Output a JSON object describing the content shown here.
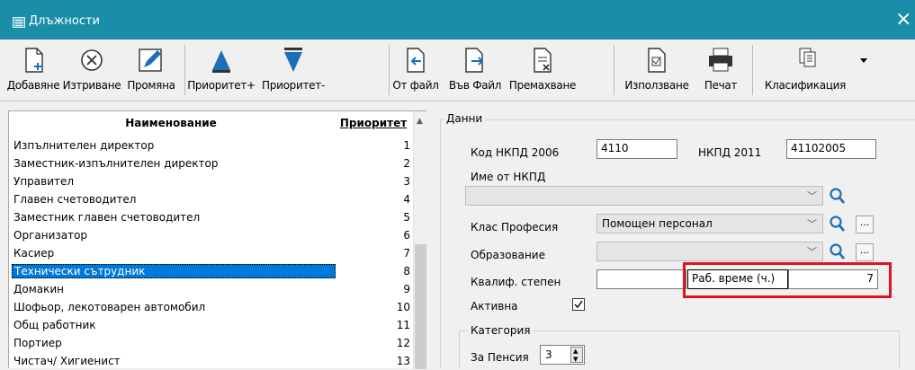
{
  "window": {
    "title": "Длъжности",
    "close": "×"
  },
  "toolbar": {
    "add": "Добавяне",
    "delete": "Изтриване",
    "edit": "Промяна",
    "priority_up": "Приоритет+",
    "priority_down": "Приоритет-",
    "from_file": "От файл",
    "to_file": "Във Файл",
    "remove": "Премахване",
    "usage": "Използване",
    "print": "Печат",
    "classification": "Класификация"
  },
  "list": {
    "header_name": "Наименование",
    "header_priority": "Приоритет",
    "rows": [
      {
        "name": "Изпълнителен директор",
        "priority": "1"
      },
      {
        "name": "Заместник-изпълнителен директор",
        "priority": "2"
      },
      {
        "name": "Управител",
        "priority": "3"
      },
      {
        "name": "Главен счетоводител",
        "priority": "4"
      },
      {
        "name": "Заместник главен счетоводител",
        "priority": "5"
      },
      {
        "name": "Организатор",
        "priority": "6"
      },
      {
        "name": "Касиер",
        "priority": "7"
      },
      {
        "name": "Технически сътрудник",
        "priority": "8"
      },
      {
        "name": "Домакин",
        "priority": "9"
      },
      {
        "name": "Шофьор, лекотоварен автомобил",
        "priority": "10"
      },
      {
        "name": "Общ работник",
        "priority": "11"
      },
      {
        "name": "Портиер",
        "priority": "12"
      },
      {
        "name": "Чистач/ Хигиенист",
        "priority": "13"
      }
    ],
    "selected_index": 7
  },
  "data_panel": {
    "group_label": "Данни",
    "nkpd2006_label": "Код НКПД 2006",
    "nkpd2006_value": "4110",
    "nkpd2011_label": "НКПД 2011",
    "nkpd2011_value": "41102005",
    "name_label": "Име от НКПД",
    "name_value": "",
    "class_label": "Клас Професия",
    "class_value": "Помощен персонал",
    "education_label": "Образование",
    "education_value": "",
    "qualification_label": "Квалиф. степен",
    "qualification_value": "",
    "work_time_label": "Раб. време (ч.)",
    "work_time_value": "7",
    "active_label": "Активна",
    "active_checked": true,
    "category_label": "Категория",
    "pension_label": "За Пенсия",
    "pension_value": "3",
    "more_button": "..."
  },
  "colors": {
    "titlebar": "#1a8ea8",
    "selection": "#0078d7",
    "highlight_box": "#e0141e",
    "icon_blue": "#1b6fb8"
  }
}
